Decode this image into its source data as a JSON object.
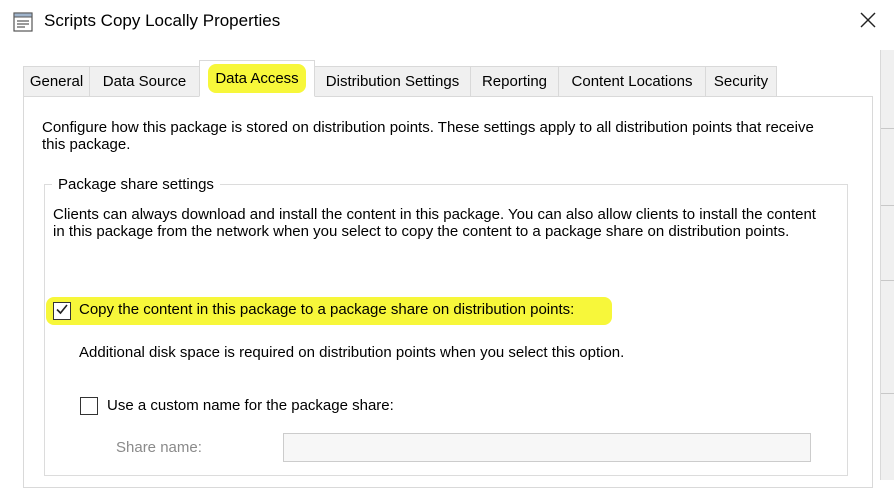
{
  "window": {
    "title": "Scripts Copy Locally Properties",
    "icon": "properties-icon"
  },
  "tabs": [
    {
      "label": "General",
      "active": false
    },
    {
      "label": "Data Source",
      "active": false
    },
    {
      "label": "Data Access",
      "active": true
    },
    {
      "label": "Distribution Settings",
      "active": false
    },
    {
      "label": "Reporting",
      "active": false
    },
    {
      "label": "Content Locations",
      "active": false
    },
    {
      "label": "Security",
      "active": false
    }
  ],
  "intro_text": "Configure how this package is stored on distribution points. These settings apply to all distribution points that receive this package.",
  "package_share": {
    "legend": "Package share settings",
    "description": "Clients can always download and install the content in this package. You can also allow clients to install the content in this package from the network when you select to copy the content to a package share on distribution points.",
    "copy_checkbox": {
      "label": "Copy the content in this package to a package share on distribution points:",
      "checked": true
    },
    "note": "Additional disk space is required on distribution points when you select this option.",
    "custom_name_checkbox": {
      "label": "Use a custom name for the package share:",
      "checked": false
    },
    "share_name": {
      "label": "Share name:",
      "value": "",
      "enabled": false
    }
  },
  "colors": {
    "highlight": "#f7f73a",
    "tab_inactive": "#f0f0f0",
    "border": "#d9d9d9",
    "disabled_text": "#8a8a8a"
  }
}
